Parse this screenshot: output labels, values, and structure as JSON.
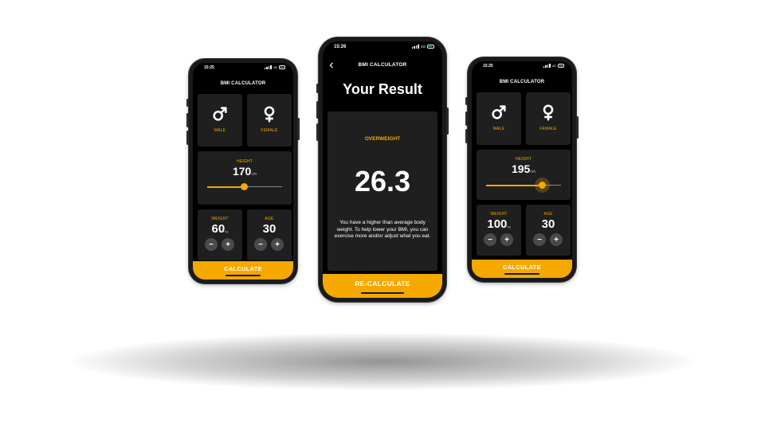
{
  "left_phone": {
    "status_time": "15:25",
    "status_network": "4G",
    "title": "BMI CALCULATOR",
    "male_label": "MALE",
    "female_label": "FEMALE",
    "height_label": "HEIGHT",
    "height_value": "170",
    "height_unit": "cm",
    "height_slider_fraction": 0.5,
    "weight_label": "WEIGHT",
    "weight_value": "60",
    "weight_unit": "kg",
    "age_label": "AGE",
    "age_value": "30",
    "minus": "−",
    "plus": "+",
    "calculate_label": "CALCULATE"
  },
  "center_phone": {
    "status_time": "15:26",
    "status_network": "4G",
    "title": "BMI CALCULATOR",
    "back_icon": "chevron-left-icon",
    "result_heading": "Your Result",
    "result_category": "OVERWEIGHT",
    "bmi_value": "26.3",
    "advice": "You have a higher than average body weight. To help lower your BMI, you can exercise more and/or adjust what you eat.",
    "recalculate_label": "RE-CALCULATE"
  },
  "right_phone": {
    "status_time": "15:25",
    "status_network": "4G",
    "title": "BMI CALCULATOR",
    "male_label": "MALE",
    "female_label": "FEMALE",
    "height_label": "HEIGHT",
    "height_value": "195",
    "height_unit": "cm",
    "height_slider_fraction": 0.75,
    "weight_label": "WEIGHT",
    "weight_value": "100",
    "weight_unit": "kg",
    "age_label": "AGE",
    "age_value": "30",
    "minus": "−",
    "plus": "+",
    "calculate_label": "CALCULATE"
  },
  "colors": {
    "accent": "#f5a800",
    "card": "#1f1f1f",
    "background": "#000000",
    "battery": "#3ddc5f"
  }
}
